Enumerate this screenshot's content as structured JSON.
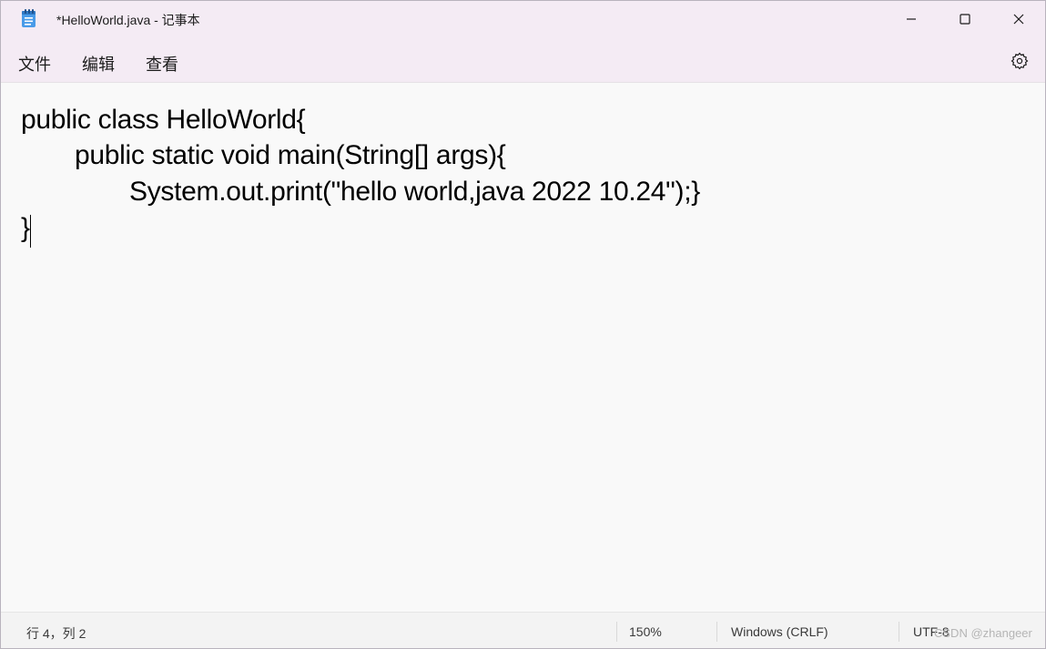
{
  "window": {
    "title": "*HelloWorld.java - 记事本",
    "app_icon": "notepad-icon",
    "controls": {
      "minimize_icon": "minimize-icon",
      "maximize_icon": "maximize-icon",
      "close_icon": "close-icon"
    }
  },
  "menubar": {
    "items": [
      {
        "label": "文件"
      },
      {
        "label": "编辑"
      },
      {
        "label": "查看"
      }
    ],
    "settings_icon": "gear-icon"
  },
  "editor": {
    "lines": [
      "public class HelloWorld{",
      "public static void main(String[] args){",
      "System.out.print(\"hello world,java 2022 10.24\");}",
      "}"
    ],
    "indent_levels": [
      0,
      1,
      2,
      0
    ],
    "cursor": {
      "line": 4,
      "column": 2
    }
  },
  "statusbar": {
    "position": "行 4，列 2",
    "zoom": "150%",
    "line_ending": "Windows (CRLF)",
    "encoding": "UTF-8"
  },
  "watermark": "CSDN @zhangeer",
  "colors": {
    "titlebar_bg": "#f4ebf4",
    "editor_bg": "#f9f9f9",
    "statusbar_bg": "#f3f3f3",
    "text": "#000000"
  }
}
